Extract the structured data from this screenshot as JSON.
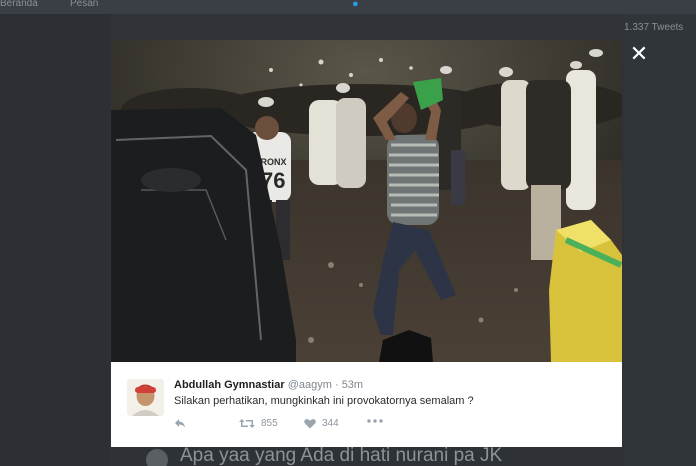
{
  "background": {
    "top_left": "Beranda",
    "top_middle": "Pesan",
    "right_label": "1.337 Tweets",
    "bottom_text": "Apa yaa yang Ada di hati nurani pa JK"
  },
  "modal": {
    "close_icon": "close-icon",
    "photo_description_icon": "protest-photo"
  },
  "tweet": {
    "name": "Abdullah Gymnastiar",
    "handle": "@aagym",
    "separator": "·",
    "time": "53m",
    "text": "Silakan perhatikan, mungkinkah ini provokatornya semalam ?",
    "retweets": "855",
    "likes": "344",
    "icons": {
      "reply": "reply-icon",
      "retweet": "retweet-icon",
      "like": "heart-icon",
      "more": "more-icon"
    }
  },
  "colors": {
    "page_bg": "#2f3338",
    "card_bg": "#ffffff",
    "muted": "#7e878f"
  }
}
